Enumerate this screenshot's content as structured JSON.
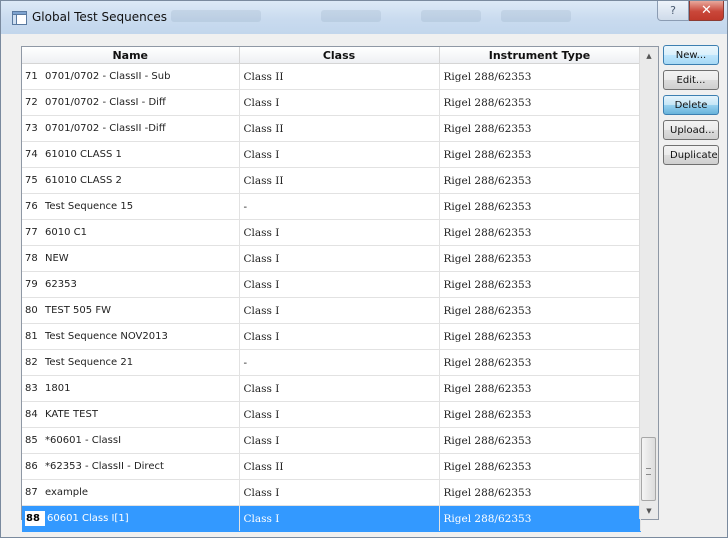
{
  "window": {
    "title": "Global Test Sequences",
    "help_glyph": "?",
    "close_glyph": "✕"
  },
  "table": {
    "columns": [
      "Name",
      "Class",
      "Instrument Type"
    ],
    "rows": [
      {
        "num": "71",
        "name": "0701/0702 - ClassII - Sub",
        "class": "Class II",
        "instrument": "Rigel 288/62353"
      },
      {
        "num": "72",
        "name": "0701/0702 - ClassI - Diff",
        "class": "Class I",
        "instrument": "Rigel 288/62353"
      },
      {
        "num": "73",
        "name": "0701/0702 - ClassII -Diff",
        "class": "Class II",
        "instrument": "Rigel 288/62353"
      },
      {
        "num": "74",
        "name": "61010 CLASS 1",
        "class": "Class I",
        "instrument": "Rigel 288/62353"
      },
      {
        "num": "75",
        "name": "61010 CLASS 2",
        "class": "Class II",
        "instrument": "Rigel 288/62353"
      },
      {
        "num": "76",
        "name": "Test Sequence 15",
        "class": "-",
        "instrument": "Rigel 288/62353"
      },
      {
        "num": "77",
        "name": "6010 C1",
        "class": "Class I",
        "instrument": "Rigel 288/62353"
      },
      {
        "num": "78",
        "name": "NEW",
        "class": "Class I",
        "instrument": "Rigel 288/62353"
      },
      {
        "num": "79",
        "name": "62353",
        "class": "Class I",
        "instrument": "Rigel 288/62353"
      },
      {
        "num": "80",
        "name": "TEST 505 FW",
        "class": "Class I",
        "instrument": "Rigel 288/62353"
      },
      {
        "num": "81",
        "name": "Test Sequence NOV2013",
        "class": "Class I",
        "instrument": "Rigel 288/62353"
      },
      {
        "num": "82",
        "name": "Test Sequence 21",
        "class": "-",
        "instrument": "Rigel 288/62353"
      },
      {
        "num": "83",
        "name": "1801",
        "class": "Class I",
        "instrument": "Rigel 288/62353"
      },
      {
        "num": "84",
        "name": "KATE TEST",
        "class": "Class I",
        "instrument": "Rigel 288/62353"
      },
      {
        "num": "85",
        "name": "*60601 - ClassI",
        "class": "Class I",
        "instrument": "Rigel 288/62353"
      },
      {
        "num": "86",
        "name": "*62353 - ClassII - Direct",
        "class": "Class II",
        "instrument": "Rigel 288/62353"
      },
      {
        "num": "87",
        "name": "example",
        "class": "Class I",
        "instrument": "Rigel 288/62353"
      },
      {
        "num": "88",
        "name": "60601 Class I[1]",
        "class": "Class I",
        "instrument": "Rigel 288/62353",
        "selected": true
      }
    ]
  },
  "buttons": {
    "new": "New...",
    "edit": "Edit...",
    "delete": "Delete",
    "upload": "Upload...",
    "duplicate": "Duplicate"
  },
  "colors": {
    "selection": "#3399ff",
    "title_bar": "#c9dbef",
    "close_button": "#c9473a"
  }
}
